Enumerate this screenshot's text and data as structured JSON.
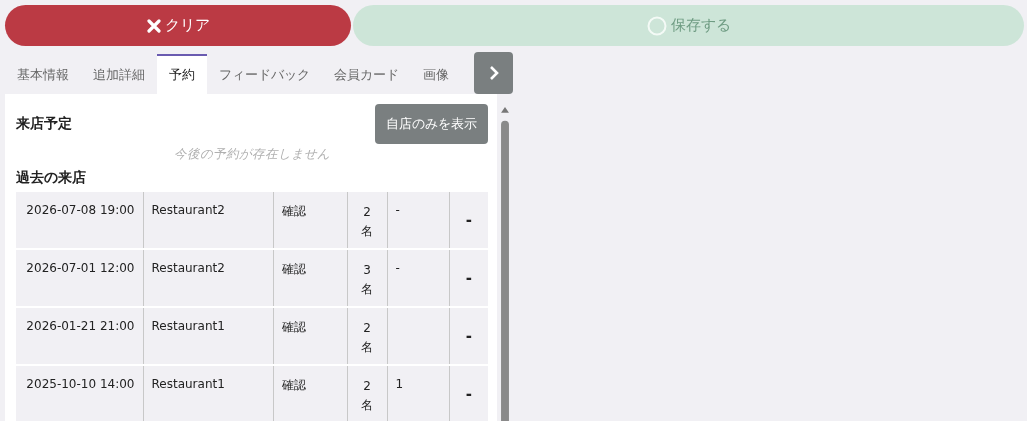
{
  "actions": [
    {
      "kind": "clear",
      "label": "クリア",
      "disabled": false
    },
    {
      "kind": "save",
      "label": "保存する",
      "disabled": true
    }
  ],
  "tabs": [
    {
      "label": "基本情報",
      "selected": false
    },
    {
      "label": "追加詳細",
      "selected": false
    },
    {
      "label": "予約",
      "selected": true
    },
    {
      "label": "フィードバック",
      "selected": false
    },
    {
      "label": "会員カード",
      "selected": false
    },
    {
      "label": "画像",
      "selected": false
    }
  ],
  "upcoming": {
    "title": "来店予定",
    "filter_button": "自店のみを表示",
    "empty_message": "今後の予約が存在しません"
  },
  "past": {
    "title": "過去の来店",
    "rows": [
      {
        "datetime": "2026-07-08 19:00",
        "restaurant": "Restaurant2",
        "status": "確認",
        "party": "2名",
        "column_5": "-",
        "column_6": "-"
      },
      {
        "datetime": "2026-07-01 12:00",
        "restaurant": "Restaurant2",
        "status": "確認",
        "party": "3名",
        "column_5": "-",
        "column_6": "-"
      },
      {
        "datetime": "2026-01-21 21:00",
        "restaurant": "Restaurant1",
        "status": "確認",
        "party": "2名",
        "column_6": "-"
      },
      {
        "datetime": "2025-10-10 14:00",
        "restaurant": "Restaurant1",
        "status": "確認",
        "party": "2名",
        "column_5": "1",
        "column_6": "-"
      }
    ]
  }
}
